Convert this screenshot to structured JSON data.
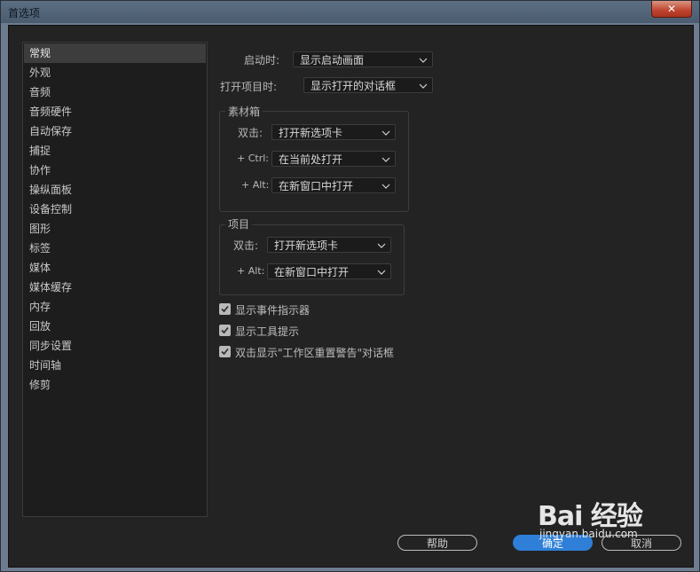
{
  "window": {
    "title": "首选项",
    "close_label": "✕"
  },
  "sidebar": {
    "items": [
      "常规",
      "外观",
      "音频",
      "音频硬件",
      "自动保存",
      "捕捉",
      "协作",
      "操纵面板",
      "设备控制",
      "图形",
      "标签",
      "媒体",
      "媒体缓存",
      "内存",
      "回放",
      "同步设置",
      "时间轴",
      "修剪"
    ],
    "selected": "常规"
  },
  "general": {
    "startup_label": "启动时:",
    "startup_value": "显示启动画面",
    "open_project_label": "打开项目时:",
    "open_project_value": "显示打开的对话框"
  },
  "bin": {
    "title": "素材箱",
    "double_click_label": "双击:",
    "double_click_value": "打开新选项卡",
    "ctrl_label": "+ Ctrl:",
    "ctrl_value": "在当前处打开",
    "alt_label": "+ Alt:",
    "alt_value": "在新窗口中打开"
  },
  "project": {
    "title": "项目",
    "double_click_label": "双击:",
    "double_click_value": "打开新选项卡",
    "alt_label": "+ Alt:",
    "alt_value": "在新窗口中打开"
  },
  "checkboxes": [
    {
      "label": "显示事件指示器",
      "checked": true
    },
    {
      "label": "显示工具提示",
      "checked": true
    },
    {
      "label": "双击显示\"工作区重置警告\"对话框",
      "checked": true
    }
  ],
  "buttons": {
    "help": "帮助",
    "ok": "确定",
    "cancel": "取消"
  },
  "watermark": {
    "brand": "Bai 经验",
    "url": "jingyan.baidu.com"
  },
  "colors": {
    "accent": "#2f7fd8",
    "panel_bg": "#232323",
    "sidebar_selected": "#3d3d3d"
  }
}
